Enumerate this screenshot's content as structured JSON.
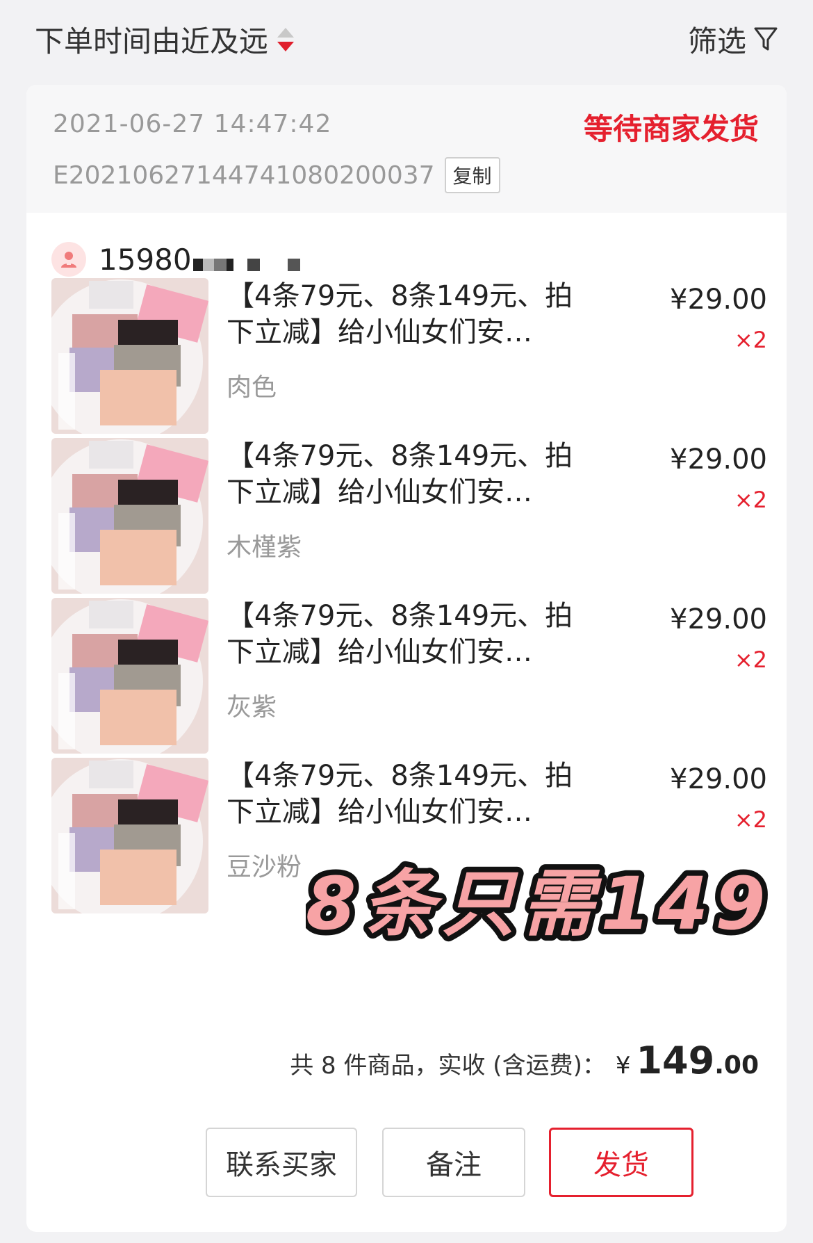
{
  "topbar": {
    "sort_label": "下单时间由近及远",
    "filter_label": "筛选"
  },
  "order": {
    "time": "2021-06-27 14:47:42",
    "status": "等待商家发货",
    "order_no": "E20210627144741080200037",
    "copy_label": "复制",
    "buyer_phone": "15980"
  },
  "items": [
    {
      "title": "【4条79元、8条149元、拍下立减】给小仙女们安…",
      "variant": "肉色",
      "price": "¥29.00",
      "qty": "×2"
    },
    {
      "title": "【4条79元、8条149元、拍下立减】给小仙女们安…",
      "variant": "木槿紫",
      "price": "¥29.00",
      "qty": "×2"
    },
    {
      "title": "【4条79元、8条149元、拍下立减】给小仙女们安…",
      "variant": "灰紫",
      "price": "¥29.00",
      "qty": "×2"
    },
    {
      "title": "【4条79元、8条149元、拍下立减】给小仙女们安…",
      "variant": "豆沙粉",
      "price": "¥29.00",
      "qty": "×2"
    }
  ],
  "promo_text": "8条只需149",
  "summary": {
    "prefix": "共 8 件商品，实收 (含运费)：",
    "currency": "¥",
    "amount_int": "149",
    "amount_dec": ".00"
  },
  "actions": {
    "contact_label": "联系买家",
    "note_label": "备注",
    "ship_label": "发货"
  },
  "colors": {
    "accent": "#e5202e",
    "promo_fill": "#f7a3a5"
  }
}
